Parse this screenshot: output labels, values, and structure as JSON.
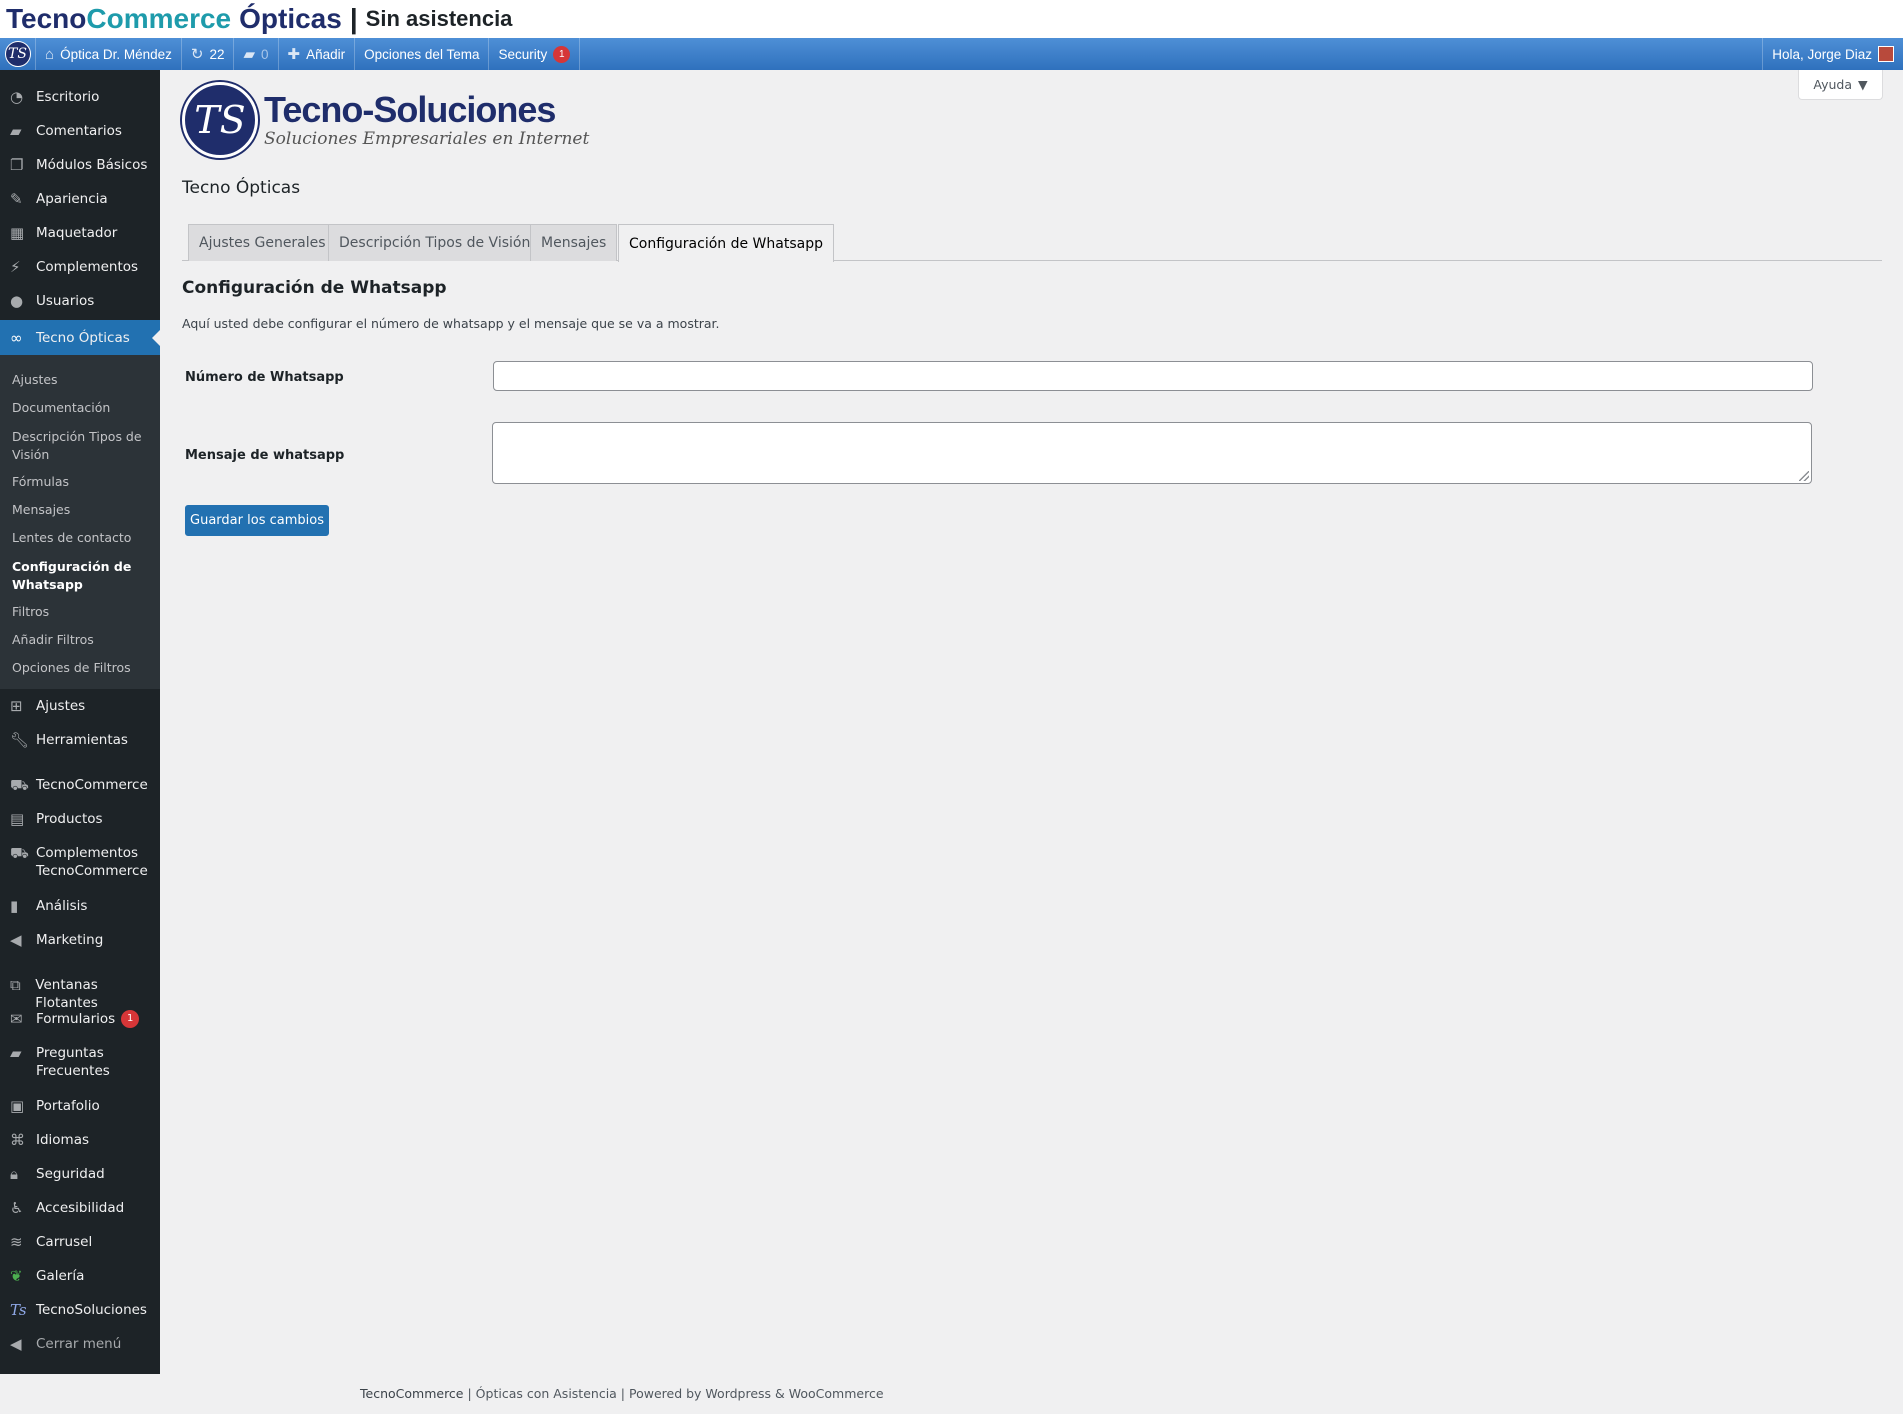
{
  "banner": {
    "part1": "Tecno",
    "part2": "Commerce",
    "part3": "Ópticas",
    "separator": "|",
    "part4": "Sin asistencia"
  },
  "adminbar": {
    "site_name": "Óptica Dr. Méndez",
    "updates_count": "22",
    "comments_count": "0",
    "add_label": "Añadir",
    "theme_options_label": "Opciones del Tema",
    "security_label": "Security",
    "security_badge": "1",
    "greeting": "Hola, Jorge Diaz",
    "logo_text": "TS"
  },
  "sidebar": {
    "items_top": [
      {
        "label": "Escritorio",
        "icon": "dashboard-icon"
      },
      {
        "label": "Comentarios",
        "icon": "comments-icon"
      },
      {
        "label": "Módulos Básicos",
        "icon": "pages-icon"
      },
      {
        "label": "Apariencia",
        "icon": "brush-icon"
      },
      {
        "label": "Maquetador",
        "icon": "grid-icon"
      },
      {
        "label": "Complementos",
        "icon": "plugin-icon"
      },
      {
        "label": "Usuarios",
        "icon": "user-icon"
      },
      {
        "label": "Tecno Ópticas",
        "icon": "glasses-icon"
      }
    ],
    "submenu": [
      "Ajustes",
      "Documentación",
      "Descripción Tipos de Visión",
      "Fórmulas",
      "Mensajes",
      "Lentes de contacto",
      "Configuración de Whatsapp",
      "Filtros",
      "Añadir Filtros",
      "Opciones de Filtros"
    ],
    "items_bottom": [
      {
        "label": "Ajustes",
        "icon": "settings-icon"
      },
      {
        "label": "Herramientas",
        "icon": "wrench-icon"
      },
      {
        "label": "TecnoCommerce",
        "icon": "cart-icon"
      },
      {
        "label": "Productos",
        "icon": "archive-icon"
      },
      {
        "label": "Complementos TecnoCommerce",
        "icon": "cart-icon"
      },
      {
        "label": "Análisis",
        "icon": "chart-icon"
      },
      {
        "label": "Marketing",
        "icon": "megaphone-icon"
      },
      {
        "label": "Ventanas Flotantes",
        "icon": "popup-icon"
      },
      {
        "label": "Formularios",
        "icon": "mail-icon",
        "badge": "1"
      },
      {
        "label": "Preguntas Frecuentes",
        "icon": "faq-icon"
      },
      {
        "label": "Portafolio",
        "icon": "portfolio-icon"
      },
      {
        "label": "Idiomas",
        "icon": "translate-icon"
      },
      {
        "label": "Seguridad",
        "icon": "lock-icon"
      },
      {
        "label": "Accesibilidad",
        "icon": "accessibility-icon"
      },
      {
        "label": "Carrusel",
        "icon": "layers-icon"
      },
      {
        "label": "Galería",
        "icon": "leaf-icon"
      },
      {
        "label": "TecnoSoluciones",
        "icon": "ts-logo-icon"
      },
      {
        "label": "Cerrar menú",
        "icon": "collapse-icon"
      }
    ]
  },
  "content": {
    "help_label": "Ayuda",
    "logo_brand": "Tecno-Soluciones",
    "logo_tagline": "Soluciones Empresariales en Internet",
    "logo_seal": "TS",
    "page_title": "Tecno Ópticas",
    "tabs": [
      "Ajustes Generales",
      "Descripción Tipos de Visión",
      "Mensajes",
      "Configuración de Whatsapp"
    ],
    "active_tab": "Configuración de Whatsapp",
    "section_title": "Configuración de Whatsapp",
    "description": "Aquí usted debe configurar el número de whatsapp y el mensaje que se va a mostrar.",
    "field_number_label": "Número de Whatsapp",
    "field_number_value": "",
    "field_message_label": "Mensaje de whatsapp",
    "field_message_value": "",
    "save_label": "Guardar los cambios"
  },
  "footer": {
    "brand": "TecnoCommerce",
    "sep1": " | ",
    "mid": "Ópticas con Asistencia",
    "sep2": " | ",
    "powered": "Powered by Wordpress & WooCommerce"
  },
  "colors": {
    "adminbar": "#2f71bd",
    "sidebar": "#1d2327",
    "accent": "#2271b1",
    "brand_navy": "#1f2d6b",
    "brand_teal": "#1e9bab",
    "badge_red": "#d63638"
  }
}
